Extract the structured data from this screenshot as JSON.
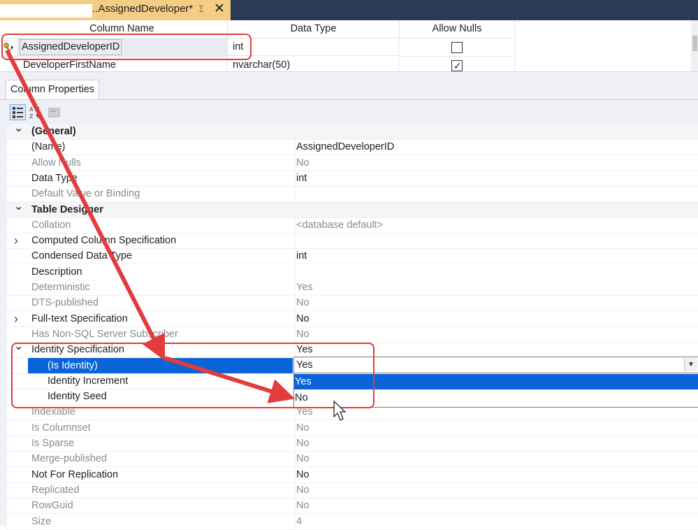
{
  "tab": {
    "title": "..AssignedDeveloper*",
    "pin_glyph": "⌶",
    "close_glyph": "✕"
  },
  "grid": {
    "headers": [
      "Column Name",
      "Data Type",
      "Allow Nulls"
    ],
    "rows": [
      {
        "name": "AssignedDeveloperID",
        "type": "int",
        "allow_nulls": false,
        "primary_key": true
      },
      {
        "name": "DeveloperFirstName",
        "type": "nvarchar(50)",
        "allow_nulls": true,
        "primary_key": false
      }
    ]
  },
  "panel": {
    "tab_label": "Column Properties",
    "toolbar": [
      "categorized-icon",
      "alphabetical-icon",
      "property-pages-icon"
    ]
  },
  "properties": [
    {
      "name": "(General)",
      "value": "",
      "kind": "category",
      "expander": "open"
    },
    {
      "name": "(Name)",
      "value": "AssignedDeveloperID"
    },
    {
      "name": "Allow Nulls",
      "value": "No",
      "disabled": true
    },
    {
      "name": "Data Type",
      "value": "int"
    },
    {
      "name": "Default Value or Binding",
      "value": "",
      "disabled": true
    },
    {
      "name": "Table Designer",
      "value": "",
      "kind": "category",
      "expander": "open"
    },
    {
      "name": "Collation",
      "value": "<database default>",
      "disabled": true
    },
    {
      "name": "Computed Column Specification",
      "value": "",
      "expander": "closed"
    },
    {
      "name": "Condensed Data Type",
      "value": "int"
    },
    {
      "name": "Description",
      "value": ""
    },
    {
      "name": "Deterministic",
      "value": "Yes",
      "disabled": true
    },
    {
      "name": "DTS-published",
      "value": "No",
      "disabled": true
    },
    {
      "name": "Full-text Specification",
      "value": "No",
      "expander": "closed"
    },
    {
      "name": "Has Non-SQL Server Subscriber",
      "value": "No",
      "disabled": true
    },
    {
      "name": "Identity Specification",
      "value": "Yes",
      "expander": "open"
    },
    {
      "name": "(Is Identity)",
      "value": "Yes",
      "indent": true,
      "selected": true
    },
    {
      "name": "Identity Increment",
      "value": "",
      "indent": true
    },
    {
      "name": "Identity Seed",
      "value": "",
      "indent": true
    },
    {
      "name": "Indexable",
      "value": "Yes",
      "disabled": true
    },
    {
      "name": "Is Columnset",
      "value": "No",
      "disabled": true
    },
    {
      "name": "Is Sparse",
      "value": "No",
      "disabled": true
    },
    {
      "name": "Merge-published",
      "value": "No",
      "disabled": true
    },
    {
      "name": "Not For Replication",
      "value": "No"
    },
    {
      "name": "Replicated",
      "value": "No",
      "disabled": true
    },
    {
      "name": "RowGuid",
      "value": "No",
      "disabled": true
    },
    {
      "name": "Size",
      "value": "4",
      "disabled": true
    }
  ],
  "dropdown": {
    "current": "Yes",
    "options": [
      "Yes",
      "No"
    ],
    "highlighted": "Yes"
  },
  "colors": {
    "tab_active": "#f5cc84",
    "titlebar": "#2b3a55",
    "selection": "#0a64d7",
    "annotation_red": "#e23c3c"
  }
}
